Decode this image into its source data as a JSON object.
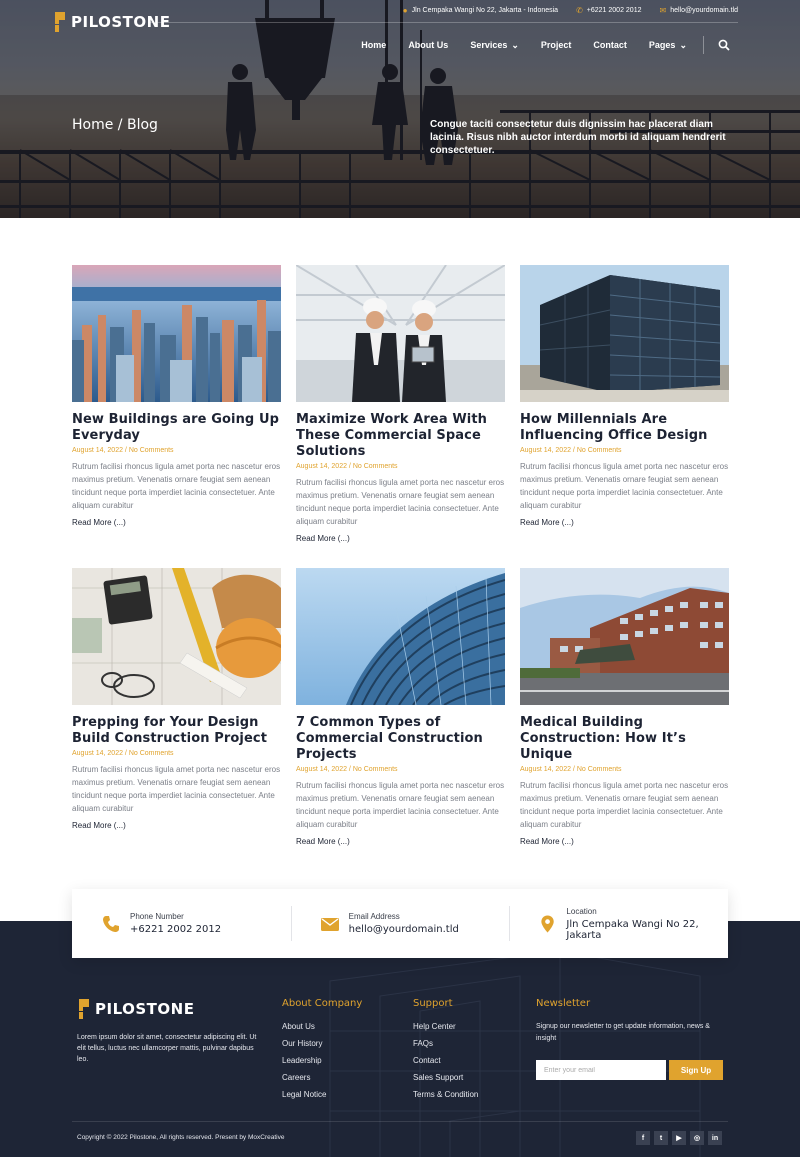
{
  "brand": {
    "name": "PILOSTONE",
    "accent": "#e0a32e",
    "dark": "#1e2536"
  },
  "topbar": {
    "address": "Jln Cempaka Wangi No 22, Jakarta - Indonesia",
    "phone": "+6221 2002 2012",
    "email": "hello@yourdomain.tld"
  },
  "nav": {
    "items": [
      {
        "label": "Home"
      },
      {
        "label": "About Us"
      },
      {
        "label": "Services",
        "dropdown": true
      },
      {
        "label": "Project"
      },
      {
        "label": "Contact"
      },
      {
        "label": "Pages",
        "dropdown": true
      }
    ],
    "search_icon": "search-icon"
  },
  "hero": {
    "breadcrumb": "Home / Blog",
    "description": "Congue taciti consectetur duis dignissim hac placerat diam lacinia. Risus nibh auctor interdum morbi id aliquam hendrerit consectetuer."
  },
  "posts": [
    {
      "title": "New Buildings are Going Up Everyday",
      "meta": "August 14, 2022 / No Comments",
      "excerpt": "Rutrum facilisi rhoncus ligula amet porta nec nascetur eros maximus pretium. Venenatis ornare feugiat sem aenean tincidunt neque porta imperdiet lacinia consectetuer. Ante aliquam curabitur",
      "more": "Read More (...)"
    },
    {
      "title": "Maximize Work Area With These Commercial Space Solutions",
      "meta": "August 14, 2022 / No Comments",
      "excerpt": "Rutrum facilisi rhoncus ligula amet porta nec nascetur eros maximus pretium. Venenatis ornare feugiat sem aenean tincidunt neque porta imperdiet lacinia consectetuer. Ante aliquam curabitur",
      "more": "Read More (...)"
    },
    {
      "title": "How Millennials Are Influencing Office Design",
      "meta": "August 14, 2022 / No Comments",
      "excerpt": "Rutrum facilisi rhoncus ligula amet porta nec nascetur eros maximus pretium. Venenatis ornare feugiat sem aenean tincidunt neque porta imperdiet lacinia consectetuer. Ante aliquam curabitur",
      "more": "Read More (...)"
    },
    {
      "title": "Prepping for Your Design Build Construction Project",
      "meta": "August 14, 2022 / No Comments",
      "excerpt": "Rutrum facilisi rhoncus ligula amet porta nec nascetur eros maximus pretium. Venenatis ornare feugiat sem aenean tincidunt neque porta imperdiet lacinia consectetuer. Ante aliquam curabitur",
      "more": "Read More (...)"
    },
    {
      "title": "7 Common Types of Commercial Construction Projects",
      "meta": "August 14, 2022 / No Comments",
      "excerpt": "Rutrum facilisi rhoncus ligula amet porta nec nascetur eros maximus pretium. Venenatis ornare feugiat sem aenean tincidunt neque porta imperdiet lacinia consectetuer. Ante aliquam curabitur",
      "more": "Read More (...)"
    },
    {
      "title": "Medical Building Construction: How It’s Unique",
      "meta": "August 14, 2022 / No Comments",
      "excerpt": "Rutrum facilisi rhoncus ligula amet porta nec nascetur eros maximus pretium. Venenatis ornare feugiat sem aenean tincidunt neque porta imperdiet lacinia consectetuer. Ante aliquam curabitur",
      "more": "Read More (...)"
    }
  ],
  "contact": {
    "phone_label": "Phone Number",
    "phone_value": "+6221 2002 2012",
    "email_label": "Email Address",
    "email_value": "hello@yourdomain.tld",
    "location_label": "Location",
    "location_value": "Jln Cempaka Wangi No 22, Jakarta"
  },
  "footer": {
    "about_text": "Lorem ipsum dolor sit amet, consectetur adipiscing elit. Ut elit tellus, luctus nec ullamcorper mattis, pulvinar dapibus leo.",
    "company_heading": "About Company",
    "company_links": [
      "About Us",
      "Our History",
      "Leadership",
      "Careers",
      "Legal Notice"
    ],
    "support_heading": "Support",
    "support_links": [
      "Help Center",
      "FAQs",
      "Contact",
      "Sales Support",
      "Terms & Condition"
    ],
    "newsletter_heading": "Newsletter",
    "newsletter_text": "Signup our newsletter to get update information, news & insight",
    "newsletter_placeholder": "Enter your email",
    "newsletter_button": "Sign Up",
    "copyright": "Copyright © 2022 Pilostone, All rights reserved. Present by MoxCreative",
    "social": [
      {
        "icon": "facebook-icon",
        "glyph": "f"
      },
      {
        "icon": "twitter-icon",
        "glyph": "t"
      },
      {
        "icon": "youtube-icon",
        "glyph": "▶"
      },
      {
        "icon": "instagram-icon",
        "glyph": "◎"
      },
      {
        "icon": "linkedin-icon",
        "glyph": "in"
      }
    ]
  }
}
